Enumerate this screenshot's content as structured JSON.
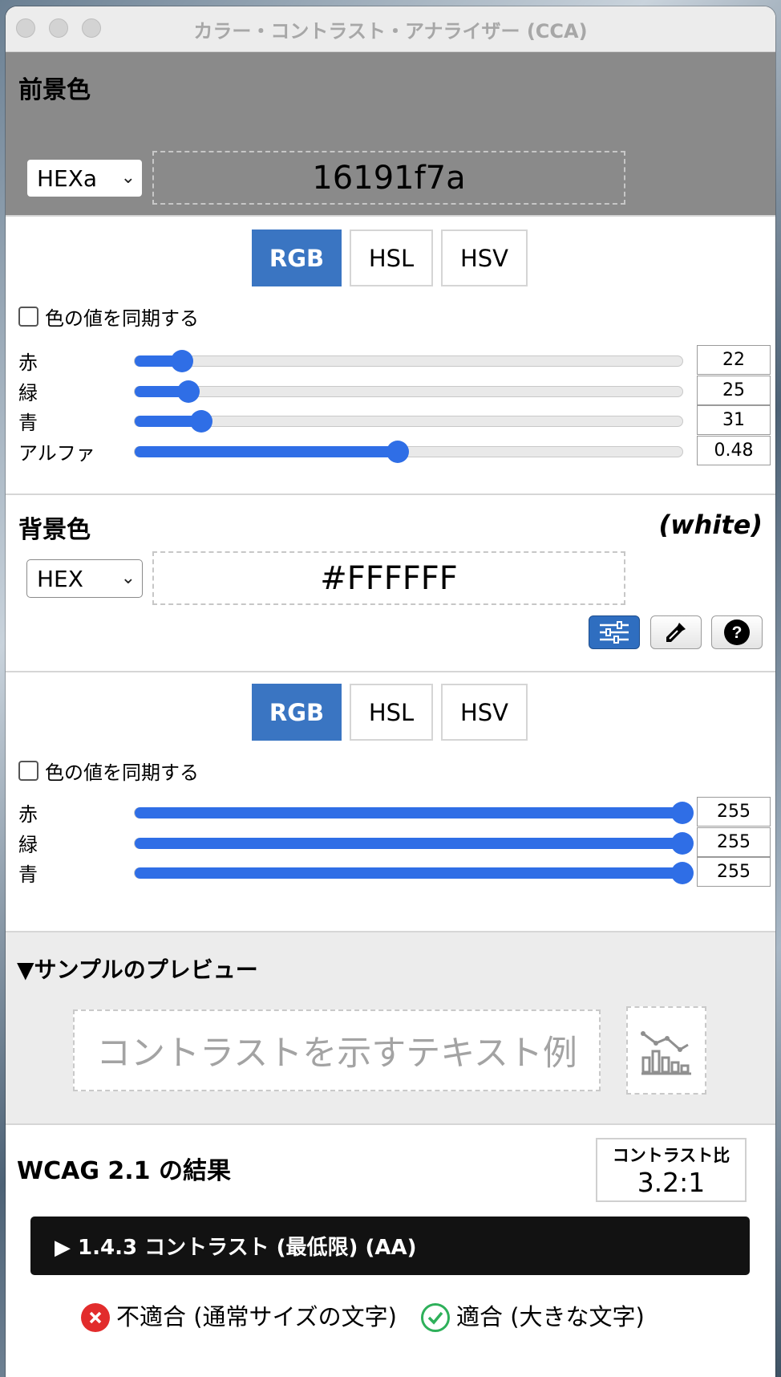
{
  "window": {
    "title": "カラー・コントラスト・アナライザー (CCA)"
  },
  "foreground": {
    "section_title": "前景色",
    "format": "HEXa",
    "value": "16191f7a",
    "tool_icons": [
      "swap-icon",
      "sliders-icon",
      "eyedropper-icon",
      "help-icon"
    ],
    "tabs": [
      "RGB",
      "HSL",
      "HSV"
    ],
    "active_tab": "RGB",
    "sync_label": "色の値を同期する",
    "sliders": [
      {
        "label": "赤",
        "value": "22",
        "fraction": 0.086
      },
      {
        "label": "緑",
        "value": "25",
        "fraction": 0.098
      },
      {
        "label": "青",
        "value": "31",
        "fraction": 0.122
      },
      {
        "label": "アルファ",
        "value": "0.48",
        "fraction": 0.48
      }
    ]
  },
  "background": {
    "section_title": "背景色",
    "color_name": "(white)",
    "format": "HEX",
    "value": "#FFFFFF",
    "tool_icons": [
      "sliders-icon",
      "eyedropper-icon",
      "help-icon"
    ],
    "tabs": [
      "RGB",
      "HSL",
      "HSV"
    ],
    "active_tab": "RGB",
    "sync_label": "色の値を同期する",
    "sliders": [
      {
        "label": "赤",
        "value": "255",
        "fraction": 1.0
      },
      {
        "label": "緑",
        "value": "255",
        "fraction": 1.0
      },
      {
        "label": "青",
        "value": "255",
        "fraction": 1.0
      }
    ]
  },
  "preview": {
    "title": "▼サンプルのプレビュー",
    "sample_text": "コントラストを示すテキスト例"
  },
  "results": {
    "title": "WCAG 2.1 の結果",
    "ratio_label": "コントラスト比",
    "ratio_value": "3.2:1",
    "criterion": "▶ 1.4.3 コントラスト (最低限) (AA)",
    "fail_text": "不適合 (通常サイズの文字)",
    "pass_text": "適合 (大きな文字)"
  },
  "colors": {
    "accent": "#3a75c2",
    "slider": "#2f6ee6",
    "fg_panel": "#8a8a8a",
    "fail": "#e22c2c",
    "pass": "#2eb05a"
  }
}
